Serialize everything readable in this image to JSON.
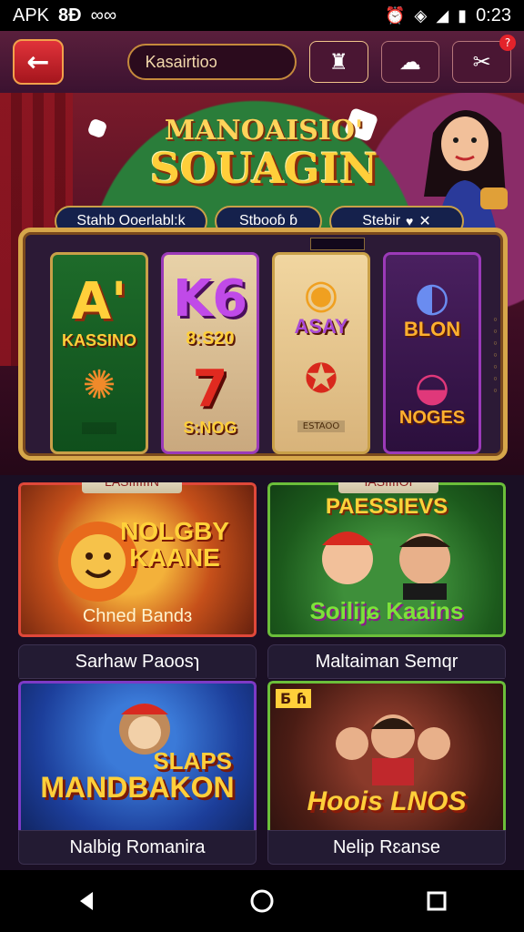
{
  "status_bar": {
    "left": [
      "APK",
      "8Ð",
      "∞∞"
    ],
    "time": "0:23"
  },
  "top_nav": {
    "search_value": "Kasairtioɔ"
  },
  "hero": {
    "title_top": "MANOAISIO'",
    "title_main": "SOUAGIN",
    "info_pills": [
      {
        "label": "Stahb Ooerlabl:k"
      },
      {
        "label": "Stbooɓ ɓ"
      },
      {
        "label": "Stebir"
      }
    ]
  },
  "reels": [
    {
      "top_label": "A'",
      "top_sub": "KASSINO",
      "bottom_caption": "",
      "symbol_top": "A'",
      "symbol_bottom": "✺"
    },
    {
      "top_label": "8:S20",
      "symbol_top": "K6",
      "symbol_bottom": "7",
      "bottom_caption": "S:NOG"
    },
    {
      "top_label": "ASAY",
      "symbol_top": "◉",
      "symbol_bottom": "✪",
      "bottom_caption": "ESTAOO"
    },
    {
      "top_label": "BLON",
      "symbol_top": "◐",
      "symbol_bottom": "◒",
      "bottom_caption": "NOGES"
    }
  ],
  "cards": [
    {
      "tag": "LASIIIIIIN",
      "title": "NOLGBY KAANE",
      "subtitle": "Chned Bandɜ",
      "caption": "Sarhaw Paoosɿ"
    },
    {
      "tag": "IASIIIIOI",
      "title_top": "PAESSIEVS",
      "title_bottom": "Soilijɕ Kaains",
      "caption": "Maltaiman Semqr"
    },
    {
      "title_top": "SLAPS",
      "title_main": "MANDBAKON",
      "caption": "Nalbig Romanira"
    },
    {
      "badge": "Ƃ ɦ",
      "title": "Hoois LNOS",
      "caption": "Nelip Rɛanse"
    }
  ],
  "colors": {
    "accent_gold": "#d6a64a",
    "back_button_red": "#e0323a",
    "notification_red": "#e3232b"
  },
  "icons": {
    "back": "arrow-left",
    "nav_1": "building",
    "nav_2": "cloud-settings",
    "nav_3": "shuffle",
    "android_back": "triangle",
    "android_home": "circle",
    "android_recent": "square"
  }
}
